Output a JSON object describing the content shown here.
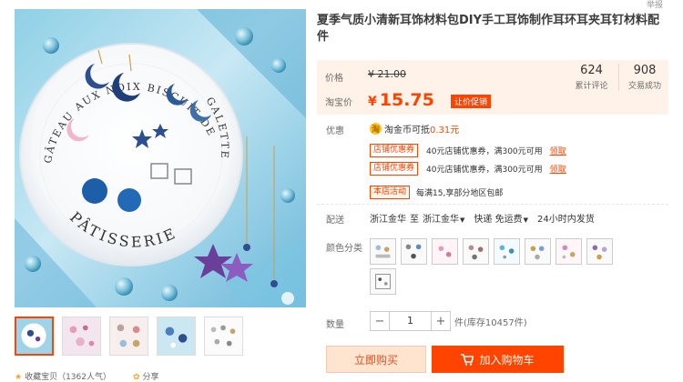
{
  "header": {
    "report_label": "举报"
  },
  "gallery": {
    "plate_text": "GÂTEAU AUX NOIX BISCUIT DE SAVOIE GALETTE PÂTISSERIE",
    "thumbnails": [
      "thumb-1",
      "thumb-2",
      "thumb-3",
      "thumb-4",
      "thumb-5"
    ],
    "favorite_label": "收藏宝贝（1362人气）",
    "share_label": "分享"
  },
  "product": {
    "title": "夏季气质小清新耳饰材料包DIY手工耳饰制作耳环耳夹耳钉材料配件"
  },
  "price": {
    "orig_label": "价格",
    "orig_value": "¥ 21.00",
    "promo_label": "淘宝价",
    "currency": "¥",
    "current_value": "15.75",
    "promo_tag": "让价促销",
    "reviews_count": "624",
    "reviews_label": "累计评论",
    "sold_count": "908",
    "sold_label": "交易成功"
  },
  "offers": {
    "label": "优惠",
    "coin_icon_text": "淘",
    "coin_text": "淘金币可抵",
    "coin_amount": "0.31元",
    "coupons": [
      {
        "tag": "店铺优惠券",
        "text": "40元店铺优惠券，满300元可用",
        "link": "领取"
      },
      {
        "tag": "店铺优惠券",
        "text": "40元店铺优惠券，满300元可用",
        "link": "领取"
      }
    ],
    "activity_tag": "本店活动",
    "activity_text": "每满15,享部分地区包邮"
  },
  "delivery": {
    "label": "配送",
    "from": "浙江金华",
    "to_word": "至",
    "to": "浙江金华",
    "shipping": "快递 免运费",
    "time": "24小时内发货"
  },
  "options": {
    "label": "颜色分类",
    "swatches": [
      "swatch-1",
      "swatch-2",
      "swatch-3",
      "swatch-4",
      "swatch-5",
      "swatch-6",
      "swatch-7",
      "swatch-8",
      "swatch-9"
    ]
  },
  "quantity": {
    "label": "数量",
    "value": "1",
    "minus": "−",
    "plus": "+",
    "stock": "件(库存10457件)"
  },
  "actions": {
    "buy_now": "立即购买",
    "add_to_cart": "加入购物车"
  },
  "colors": {
    "accent": "#ff4400",
    "price_bg": "#fff2e8"
  }
}
